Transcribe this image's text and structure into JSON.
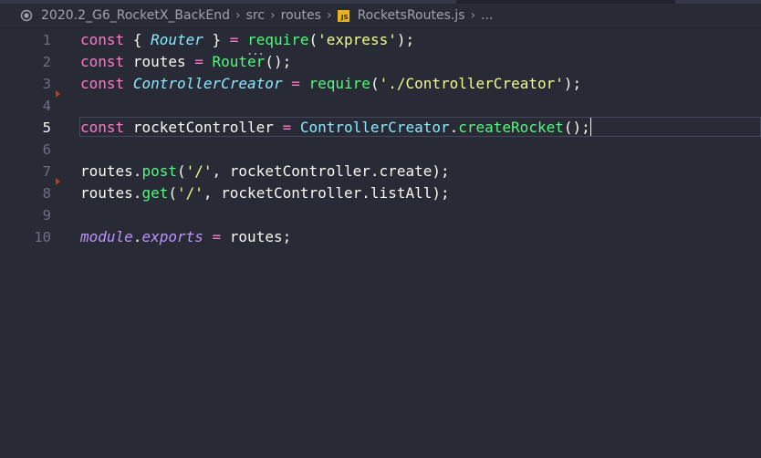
{
  "breadcrumb": {
    "repo": "2020.2_G6_RocketX_BackEnd",
    "folder1": "src",
    "folder2": "routes",
    "file": "RocketsRoutes.js",
    "file_icon_text": "JS",
    "more": "..."
  },
  "editor": {
    "current_line": 5,
    "line_numbers": [
      "1",
      "2",
      "3",
      "4",
      "5",
      "6",
      "7",
      "8",
      "9",
      "10"
    ],
    "lines": [
      {
        "t1": "const",
        "t2": " { ",
        "t3": "Router",
        "t4": " } ",
        "t5": "=",
        "t6": " ",
        "t7": "require",
        "t8": "(",
        "t9": "'express'",
        "t10": ");"
      },
      {
        "t1": "const",
        "t2": " routes ",
        "t3": "=",
        "t4": " ",
        "t5": "Router",
        "t6": "();"
      },
      {
        "t1": "const",
        "t2": " ",
        "t3": "ControllerCreator",
        "t4": " ",
        "t5": "=",
        "t6": " ",
        "t7": "require",
        "t8": "(",
        "t9": "'./ControllerCreator'",
        "t10": ");"
      },
      {},
      {
        "t1": "const",
        "t2": " rocketController ",
        "t3": "=",
        "t4": " ",
        "t5": "ControllerCreator",
        "t6": ".",
        "t7": "createRocket",
        "t8": "();"
      },
      {},
      {
        "t1": "routes",
        "t2": ".",
        "t3": "post",
        "t4": "(",
        "t5": "'/'",
        "t6": ", rocketController.",
        "t7": "create",
        "t8": ");"
      },
      {
        "t1": "routes",
        "t2": ".",
        "t3": "get",
        "t4": "(",
        "t5": "'/'",
        "t6": ", rocketController.",
        "t7": "listAll",
        "t8": ");"
      },
      {},
      {
        "t1": "module",
        "t2": ".",
        "t3": "exports",
        "t4": " ",
        "t5": "=",
        "t6": " routes;"
      }
    ],
    "hint_dots": "..."
  },
  "colors": {
    "background": "#282a36",
    "keyword": "#ff79c6",
    "function": "#50fa7b",
    "string": "#f1fa8c",
    "class": "#8be9fd",
    "text": "#f8f8f2",
    "fold_marker": "#c0392b",
    "js_icon": "#e6b422"
  }
}
